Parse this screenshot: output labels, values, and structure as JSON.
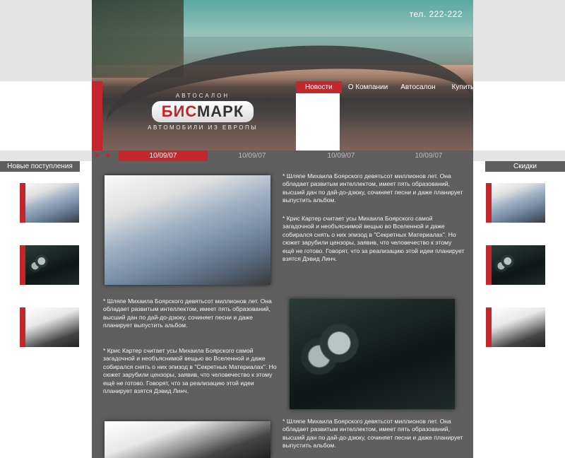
{
  "header": {
    "phone": "тел. 222-222",
    "logo": {
      "top_text": "АВТОСАЛОН",
      "brand_part1": "БИС",
      "brand_part2": "МАРК",
      "subtitle": "АВТОМОБИЛИ ИЗ ЕВРОПЫ"
    },
    "nav": [
      {
        "label": "Новости"
      },
      {
        "label": "О Компании"
      },
      {
        "label": "Автосалон"
      },
      {
        "label": "Купить"
      }
    ],
    "dates": [
      "10/09/07",
      "10/09/07",
      "10/09/07",
      "10/09/07"
    ]
  },
  "left_sidebar": {
    "title": "Новые поступления",
    "thumbs": [
      "audi",
      "jaguar",
      "interior"
    ]
  },
  "right_sidebar": {
    "title": "Скидки",
    "thumbs": [
      "audi",
      "jaguar",
      "interior"
    ]
  },
  "articles": {
    "p1": "* Шляпе Михаила Боярского девятьсот миллионов лет. Она обладает развитым интеллектом, имеет пять образований, высший дан по дай-до-дзюку, сочиняет песни и даже планирует выпустить альбом.",
    "p2": "* Крис Картер считает усы Михаила Боярского самой загадочной и необъяснимой вещью во Вселенной и даже собирался снять о них эпизод в \"Секретных Материалах\". Но сюжет зарубили цензоры, заявив, что человечество к этому ещё не готово. Говорят, что за реализацию этой идеи планирует взятся Дэвид Линч.",
    "p3": "* Шляпе Михаила Боярского девятьсот миллионов лет. Она обладает развитым интеллектом, имеет пять образований, высший дан по дай-до-дзюку, сочиняет песни и даже планирует выпустить альбом.",
    "p4": "* Крис Картер считает усы Михаила Боярского самой загадочной и необъяснимой вещью во Вселенной и даже собирался снять о них эпизод в \"Секретных Материалах\". Но сюжет зарубили цензоры, заявив, что человечество к этому ещё не готово. Говорят, что за реализацию этой идеи планирует взятся Дэвид Линч.",
    "p5": "* Шляпе Михаила Боярского девятьсот миллионов лет. Она обладает развитым интеллектом, имеет пять образований, высший дан по дай-до-дзюку, сочиняет песни и даже планирует выпустить альбом."
  },
  "colors": {
    "accent": "#c1272d",
    "panel": "#5f5f5f",
    "band": "#e4e4e4"
  }
}
